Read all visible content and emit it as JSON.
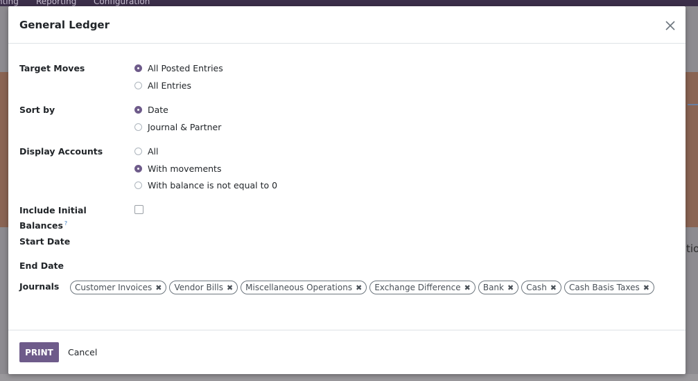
{
  "background": {
    "menu_items": [
      "nting",
      "Reporting",
      "Configuration"
    ],
    "right_text": "tio"
  },
  "dialog": {
    "title": "General Ledger",
    "close_icon": "close-icon",
    "target_moves": {
      "label": "Target Moves",
      "options": [
        "All Posted Entries",
        "All Entries"
      ],
      "selected": "All Posted Entries"
    },
    "sort_by": {
      "label": "Sort by",
      "options": [
        "Date",
        "Journal & Partner"
      ],
      "selected": "Date"
    },
    "display_accounts": {
      "label": "Display Accounts",
      "options": [
        "All",
        "With movements",
        "With balance is not equal to 0"
      ],
      "selected": "With movements"
    },
    "include_initial_balances": {
      "label_line1": "Include Initial",
      "label_line2": "Balances",
      "help_mark": "?",
      "checked": false
    },
    "start_date": {
      "label": "Start Date"
    },
    "end_date": {
      "label": "End Date"
    },
    "journals": {
      "label": "Journals",
      "tags": [
        "Customer Invoices",
        "Vendor Bills",
        "Miscellaneous Operations",
        "Exchange Difference",
        "Bank",
        "Cash",
        "Cash Basis Taxes"
      ],
      "remove_glyph": "✖"
    },
    "footer": {
      "print_label": "PRINT",
      "cancel_label": "Cancel"
    }
  },
  "colors": {
    "primary": "#6e5b8a",
    "topbar": "#3c2f4a"
  }
}
